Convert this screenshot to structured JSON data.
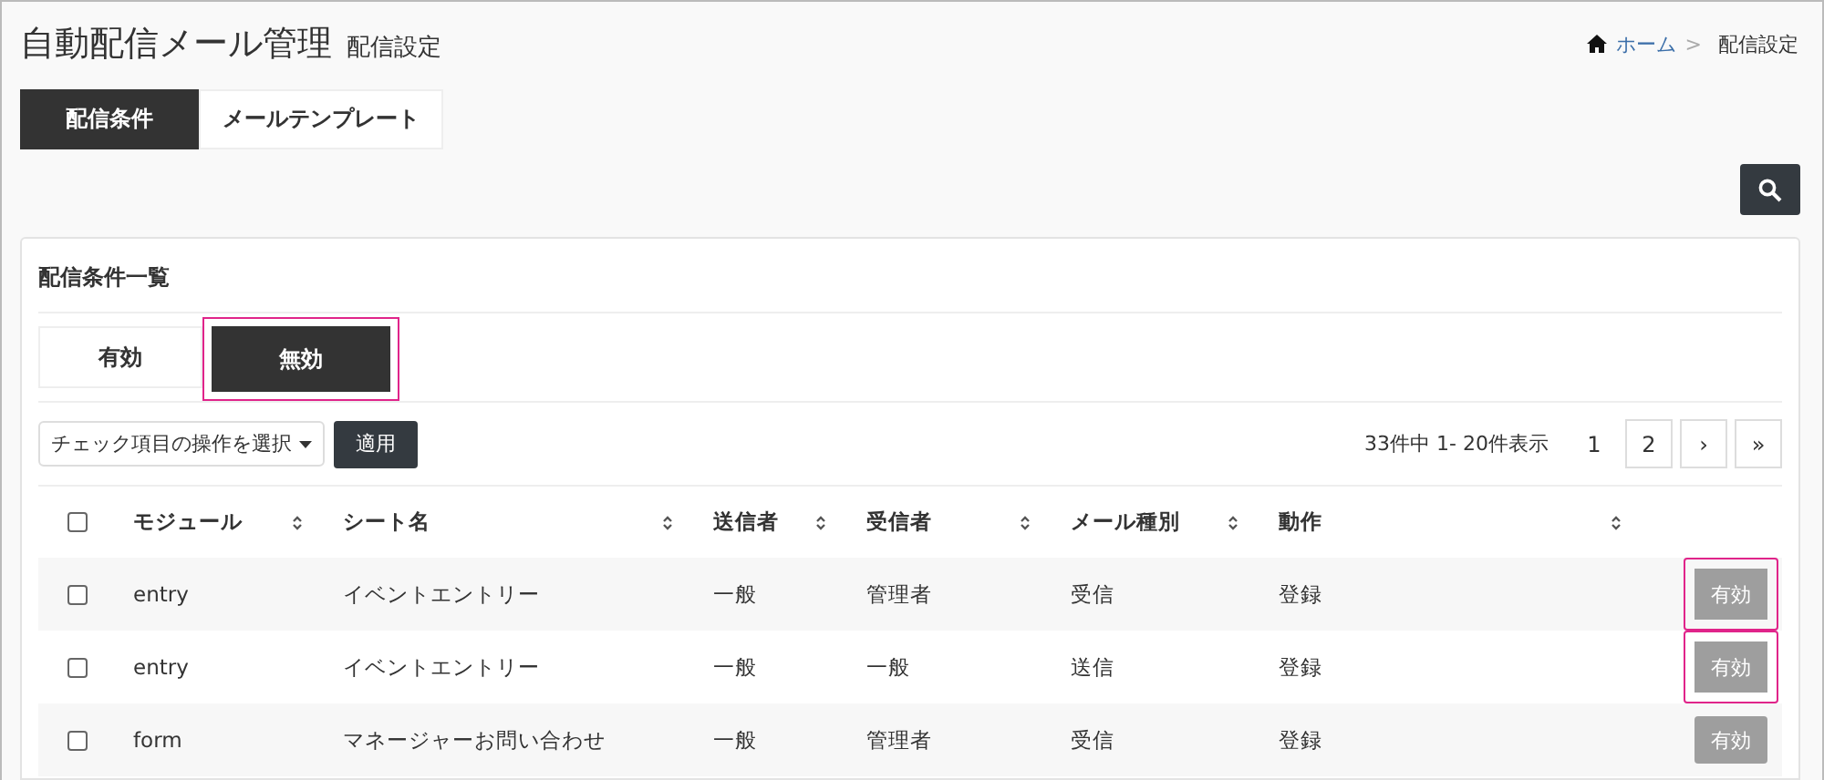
{
  "header": {
    "title": "自動配信メール管理",
    "subtitle": "配信設定"
  },
  "breadcrumb": [
    {
      "label": "ホーム",
      "kind": "link"
    },
    {
      "label": "配信設定",
      "kind": "current"
    }
  ],
  "breadcrumb_separator": ">",
  "tabs": [
    {
      "label": "配信条件",
      "selected": true
    },
    {
      "label": "メールテンプレート",
      "selected": false
    }
  ],
  "card": {
    "title": "配信条件一覧"
  },
  "status_tabs": [
    {
      "label": "有効",
      "selected": false,
      "highlighted": false
    },
    {
      "label": "無効",
      "selected": true,
      "highlighted": true
    }
  ],
  "bulk_action": {
    "label": "チェック項目の操作を選択",
    "apply": "適用"
  },
  "pagination": {
    "summary": "33件中 1- 20件表示",
    "pages": [
      {
        "label": "1",
        "selected": true
      },
      {
        "label": "2",
        "selected": false
      },
      {
        "label": "›",
        "selected": false
      },
      {
        "label": "»",
        "selected": false
      }
    ]
  },
  "table": {
    "header_checked": false,
    "columns": [
      "モジュール",
      "シート名",
      "送信者",
      "受信者",
      "メール種別",
      "動作"
    ],
    "rows": [
      {
        "checked": false,
        "cells": [
          "entry",
          "イベントエントリー",
          "一般",
          "管理者",
          "受信",
          "登録"
        ],
        "button": "有効",
        "highlighted": true
      },
      {
        "checked": false,
        "cells": [
          "entry",
          "イベントエントリー",
          "一般",
          "一般",
          "送信",
          "登録"
        ],
        "button": "有効",
        "highlighted": true
      },
      {
        "checked": false,
        "cells": [
          "form",
          "マネージャーお問い合わせ",
          "一般",
          "管理者",
          "受信",
          "登録"
        ],
        "button": "有効",
        "highlighted": false
      }
    ]
  }
}
